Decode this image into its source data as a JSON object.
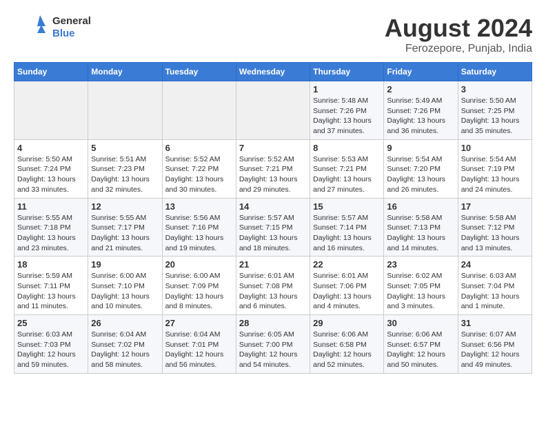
{
  "header": {
    "logo_general": "General",
    "logo_blue": "Blue",
    "main_title": "August 2024",
    "subtitle": "Ferozepore, Punjab, India"
  },
  "days_of_week": [
    "Sunday",
    "Monday",
    "Tuesday",
    "Wednesday",
    "Thursday",
    "Friday",
    "Saturday"
  ],
  "weeks": [
    [
      {
        "day": "",
        "info": ""
      },
      {
        "day": "",
        "info": ""
      },
      {
        "day": "",
        "info": ""
      },
      {
        "day": "",
        "info": ""
      },
      {
        "day": "1",
        "info": "Sunrise: 5:48 AM\nSunset: 7:26 PM\nDaylight: 13 hours\nand 37 minutes."
      },
      {
        "day": "2",
        "info": "Sunrise: 5:49 AM\nSunset: 7:26 PM\nDaylight: 13 hours\nand 36 minutes."
      },
      {
        "day": "3",
        "info": "Sunrise: 5:50 AM\nSunset: 7:25 PM\nDaylight: 13 hours\nand 35 minutes."
      }
    ],
    [
      {
        "day": "4",
        "info": "Sunrise: 5:50 AM\nSunset: 7:24 PM\nDaylight: 13 hours\nand 33 minutes."
      },
      {
        "day": "5",
        "info": "Sunrise: 5:51 AM\nSunset: 7:23 PM\nDaylight: 13 hours\nand 32 minutes."
      },
      {
        "day": "6",
        "info": "Sunrise: 5:52 AM\nSunset: 7:22 PM\nDaylight: 13 hours\nand 30 minutes."
      },
      {
        "day": "7",
        "info": "Sunrise: 5:52 AM\nSunset: 7:21 PM\nDaylight: 13 hours\nand 29 minutes."
      },
      {
        "day": "8",
        "info": "Sunrise: 5:53 AM\nSunset: 7:21 PM\nDaylight: 13 hours\nand 27 minutes."
      },
      {
        "day": "9",
        "info": "Sunrise: 5:54 AM\nSunset: 7:20 PM\nDaylight: 13 hours\nand 26 minutes."
      },
      {
        "day": "10",
        "info": "Sunrise: 5:54 AM\nSunset: 7:19 PM\nDaylight: 13 hours\nand 24 minutes."
      }
    ],
    [
      {
        "day": "11",
        "info": "Sunrise: 5:55 AM\nSunset: 7:18 PM\nDaylight: 13 hours\nand 23 minutes."
      },
      {
        "day": "12",
        "info": "Sunrise: 5:55 AM\nSunset: 7:17 PM\nDaylight: 13 hours\nand 21 minutes."
      },
      {
        "day": "13",
        "info": "Sunrise: 5:56 AM\nSunset: 7:16 PM\nDaylight: 13 hours\nand 19 minutes."
      },
      {
        "day": "14",
        "info": "Sunrise: 5:57 AM\nSunset: 7:15 PM\nDaylight: 13 hours\nand 18 minutes."
      },
      {
        "day": "15",
        "info": "Sunrise: 5:57 AM\nSunset: 7:14 PM\nDaylight: 13 hours\nand 16 minutes."
      },
      {
        "day": "16",
        "info": "Sunrise: 5:58 AM\nSunset: 7:13 PM\nDaylight: 13 hours\nand 14 minutes."
      },
      {
        "day": "17",
        "info": "Sunrise: 5:58 AM\nSunset: 7:12 PM\nDaylight: 13 hours\nand 13 minutes."
      }
    ],
    [
      {
        "day": "18",
        "info": "Sunrise: 5:59 AM\nSunset: 7:11 PM\nDaylight: 13 hours\nand 11 minutes."
      },
      {
        "day": "19",
        "info": "Sunrise: 6:00 AM\nSunset: 7:10 PM\nDaylight: 13 hours\nand 10 minutes."
      },
      {
        "day": "20",
        "info": "Sunrise: 6:00 AM\nSunset: 7:09 PM\nDaylight: 13 hours\nand 8 minutes."
      },
      {
        "day": "21",
        "info": "Sunrise: 6:01 AM\nSunset: 7:08 PM\nDaylight: 13 hours\nand 6 minutes."
      },
      {
        "day": "22",
        "info": "Sunrise: 6:01 AM\nSunset: 7:06 PM\nDaylight: 13 hours\nand 4 minutes."
      },
      {
        "day": "23",
        "info": "Sunrise: 6:02 AM\nSunset: 7:05 PM\nDaylight: 13 hours\nand 3 minutes."
      },
      {
        "day": "24",
        "info": "Sunrise: 6:03 AM\nSunset: 7:04 PM\nDaylight: 13 hours\nand 1 minute."
      }
    ],
    [
      {
        "day": "25",
        "info": "Sunrise: 6:03 AM\nSunset: 7:03 PM\nDaylight: 12 hours\nand 59 minutes."
      },
      {
        "day": "26",
        "info": "Sunrise: 6:04 AM\nSunset: 7:02 PM\nDaylight: 12 hours\nand 58 minutes."
      },
      {
        "day": "27",
        "info": "Sunrise: 6:04 AM\nSunset: 7:01 PM\nDaylight: 12 hours\nand 56 minutes."
      },
      {
        "day": "28",
        "info": "Sunrise: 6:05 AM\nSunset: 7:00 PM\nDaylight: 12 hours\nand 54 minutes."
      },
      {
        "day": "29",
        "info": "Sunrise: 6:06 AM\nSunset: 6:58 PM\nDaylight: 12 hours\nand 52 minutes."
      },
      {
        "day": "30",
        "info": "Sunrise: 6:06 AM\nSunset: 6:57 PM\nDaylight: 12 hours\nand 50 minutes."
      },
      {
        "day": "31",
        "info": "Sunrise: 6:07 AM\nSunset: 6:56 PM\nDaylight: 12 hours\nand 49 minutes."
      }
    ]
  ]
}
